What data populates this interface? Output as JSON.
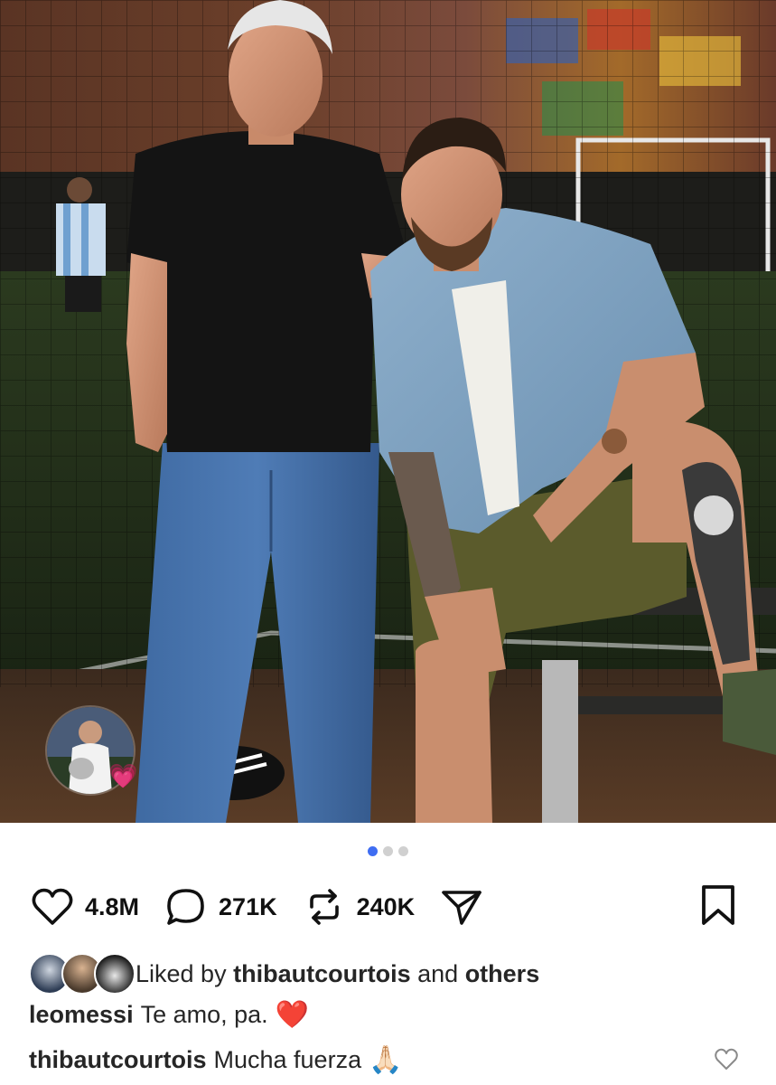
{
  "colors": {
    "accent": "#3f6df2",
    "text": "#262626",
    "heart_red": "#e0242b"
  },
  "carousel": {
    "total": 3,
    "active": 1
  },
  "actions": {
    "like": {
      "icon": "heart-outline-icon",
      "count": "4.8M"
    },
    "comment": {
      "icon": "comment-bubble-icon",
      "count": "271K"
    },
    "repost": {
      "icon": "repost-icon",
      "count": "240K"
    },
    "share": {
      "icon": "paper-plane-icon"
    },
    "save": {
      "icon": "bookmark-icon"
    }
  },
  "likes": {
    "prefix": "Liked by",
    "user": "thibautcourtois",
    "middle": "and",
    "suffix": "others"
  },
  "caption": {
    "username": "leomessi",
    "text": "Te amo, pa.",
    "emoji": "❤️"
  },
  "comment": {
    "username": "thibautcourtois",
    "text": "Mucha fuerza",
    "emoji": "🙏🏻"
  },
  "story": {
    "emoji": "💗"
  }
}
